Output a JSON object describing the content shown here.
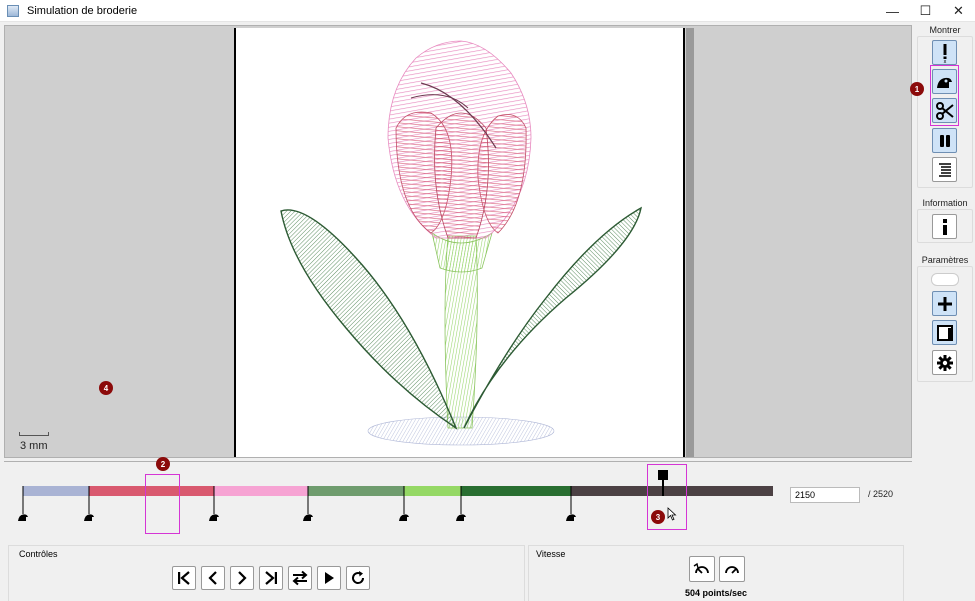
{
  "window": {
    "title": "Simulation de broderie",
    "minimize": "—",
    "maximize": "☐",
    "close": "✕"
  },
  "canvas": {
    "scale_label": "3 mm",
    "marker_4": "4"
  },
  "sidebar": {
    "show_title": "Montrer",
    "info_title": "Information",
    "params_title": "Paramètres",
    "marker_1": "1"
  },
  "timeline": {
    "segments": [
      {
        "color": "#a9b3d4",
        "width": 66
      },
      {
        "color": "#d9596f",
        "width": 125
      },
      {
        "color": "#f6a3d3",
        "width": 94
      },
      {
        "color": "#6f9c6e",
        "width": 96
      },
      {
        "color": "#95d865",
        "width": 57
      },
      {
        "color": "#296e31",
        "width": 110
      },
      {
        "color": "#4c4144",
        "width": 202
      }
    ],
    "current_value": "2150",
    "total_label": "/ 2520",
    "marker_2": "2",
    "marker_3": "3"
  },
  "controls": {
    "title": "Contrôles"
  },
  "speed": {
    "title": "Vitesse",
    "rate_label": "504 points/sec"
  },
  "colors": {
    "accent": "#d535d5",
    "marker": "#8b0a0a",
    "button_active": "#cfe3f7"
  }
}
